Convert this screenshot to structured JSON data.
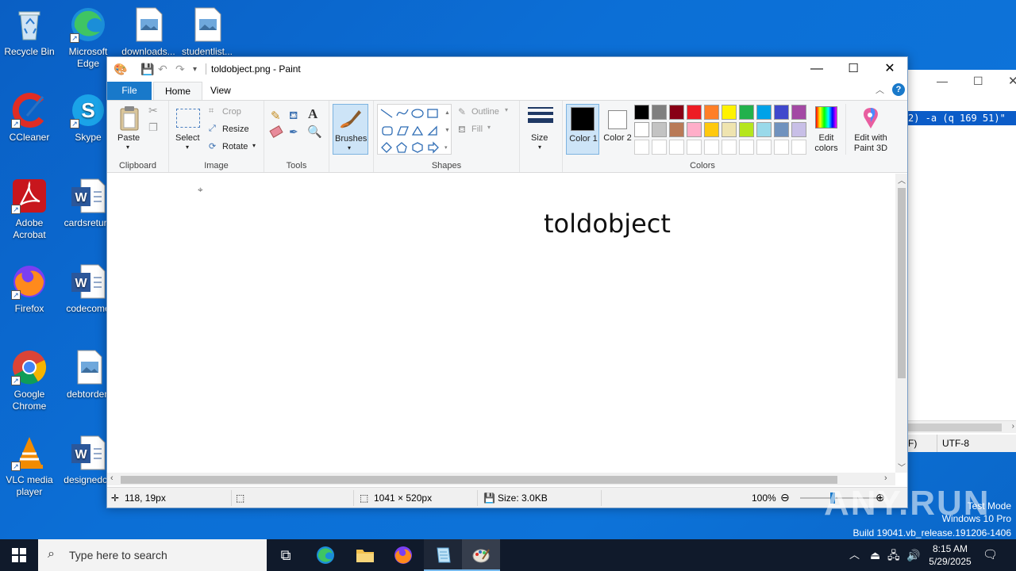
{
  "desktop": {
    "icons": [
      {
        "label": "Recycle Bin"
      },
      {
        "label": "Microsoft Edge"
      },
      {
        "label": "downloads..."
      },
      {
        "label": "studentlist..."
      },
      {
        "label": "CCleaner"
      },
      {
        "label": "Skype"
      },
      {
        "label": "Adobe Acrobat"
      },
      {
        "label": "cardsreturn"
      },
      {
        "label": "Firefox"
      },
      {
        "label": "codecome"
      },
      {
        "label": "Google Chrome"
      },
      {
        "label": "debtorder."
      },
      {
        "label": "VLC media player"
      },
      {
        "label": "designedch"
      }
    ]
  },
  "background_window": {
    "command_text": "2) -a (q 169 51)\"",
    "status_eol": "F)",
    "status_encoding": "UTF-8"
  },
  "paint": {
    "title": "toldobject.png - Paint",
    "tabs": {
      "file": "File",
      "home": "Home",
      "view": "View"
    },
    "ribbon": {
      "clipboard": {
        "paste": "Paste",
        "label": "Clipboard"
      },
      "image": {
        "select": "Select",
        "crop": "Crop",
        "resize": "Resize",
        "rotate": "Rotate",
        "label": "Image"
      },
      "tools": {
        "label": "Tools"
      },
      "brushes": {
        "label": "Brushes"
      },
      "shapes": {
        "outline": "Outline",
        "fill": "Fill",
        "label": "Shapes"
      },
      "size": {
        "label": "Size"
      },
      "colors": {
        "color1": "Color 1",
        "color2": "Color 2",
        "edit_colors": "Edit colors",
        "edit_paint3d": "Edit with Paint 3D",
        "label": "Colors",
        "color1_value": "#000000",
        "color2_value": "#ffffff",
        "palette_row1": [
          "#000000",
          "#7f7f7f",
          "#880015",
          "#ed1c24",
          "#ff7f27",
          "#fff200",
          "#22b14c",
          "#00a2e8",
          "#3f48cc",
          "#a349a4"
        ],
        "palette_row2": [
          "#ffffff",
          "#c3c3c3",
          "#b97a57",
          "#ffaec9",
          "#ffc90e",
          "#efe4b0",
          "#b5e61d",
          "#99d9ea",
          "#7092be",
          "#c8bfe7"
        ],
        "palette_row3": [
          "#ffffff",
          "#ffffff",
          "#ffffff",
          "#ffffff",
          "#ffffff",
          "#ffffff",
          "#ffffff",
          "#ffffff",
          "#ffffff",
          "#ffffff"
        ]
      }
    },
    "canvas_text": "toldobject",
    "status": {
      "cursor_pos": "118, 19px",
      "image_size": "1041 × 520px",
      "file_size": "Size: 3.0KB",
      "zoom": "100%"
    }
  },
  "taskbar": {
    "search_placeholder": "Type here to search",
    "time": "8:15 AM",
    "date": "5/29/2025"
  },
  "watermark": {
    "brand": "ANY.RUN",
    "test_mode": "Test Mode",
    "os": "Windows 10 Pro",
    "build": "Build 19041.vb_release.191206-1406"
  }
}
